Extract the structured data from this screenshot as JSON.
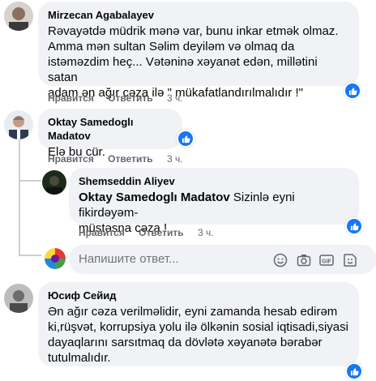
{
  "comments": [
    {
      "author": "Mirzecan Agabalayev",
      "lines": [
        "Rəvayətdə müdrik mənə var, bunu inkar etmək olmaz.",
        "Amma mən sultan Səlim deyiləm və olmaq da",
        "istəməzdim heç... Vətəninə xəyanət edən, millətini satan",
        "adam ən ağır cəza ilə \" mükafatlandırılmalıdır !\""
      ],
      "like_label": "Нравится",
      "reply_label": "Ответить",
      "time": "3 ч."
    },
    {
      "author": "Oktay Samedoglı Madatov",
      "lines": [
        "Elə bu cür."
      ],
      "like_label": "Нравится",
      "reply_label": "Ответить",
      "time": "3 ч."
    },
    {
      "author": "Shemseddin Aliyev",
      "mention": "Oktay Samedoglı Madatov",
      "first_line_rest": " Sizinlə eyni fikirdəyəm-",
      "lines": [
        "müstəsna cəza !"
      ],
      "like_label": "Нравится",
      "reply_label": "Ответить",
      "time": "3 ч."
    },
    {
      "author": "Юсиф Сейид",
      "lines": [
        "Ən ağır cəza verilməlidir, eyni zamanda hesab edirəm",
        "ki,rüşvət, korrupsiya yolu ilə ölkənin sosial iqtisadi,siyasi",
        "dayaqlarını sarsıtmaq da dövlətə xəyanətə bərabər",
        "tutulmalıdır."
      ]
    }
  ],
  "reply_input": {
    "placeholder": "Напишите ответ..."
  },
  "colors": {
    "like_blue": "#1877f2",
    "bubble": "#f0f2f5",
    "meta": "#65676b"
  },
  "icons": [
    "like-reaction-icon",
    "emoji-icon",
    "camera-icon",
    "gif-icon",
    "sticker-icon"
  ]
}
